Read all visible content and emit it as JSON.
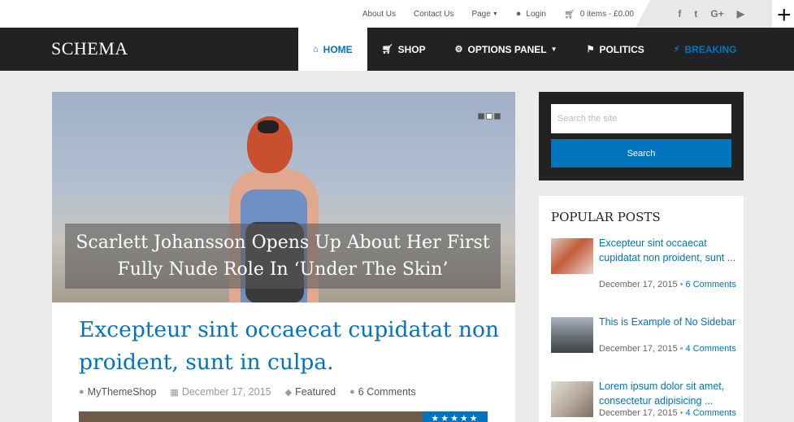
{
  "topbar": {
    "links": [
      "About Us",
      "Contact Us",
      "Page",
      "Login",
      "0 items - £0.00"
    ],
    "social_icons": [
      "facebook-icon",
      "twitter-icon",
      "google-plus-icon",
      "youtube-icon"
    ]
  },
  "brand": "SCHEMA",
  "menu": {
    "home": "HOME",
    "shop": "SHOP",
    "options": "OPTIONS PANEL",
    "politics": "POLITICS",
    "breaking": "BREAKING"
  },
  "slider": {
    "caption": "Scarlett Johansson Opens Up About Her First Fully Nude Role In ‘Under The Skin’",
    "dots": 3,
    "active_dot": 2
  },
  "post": {
    "title": "Excepteur sint occaecat cupidatat non proident, sunt in culpa.",
    "author": "MyThemeShop",
    "date": "December 17, 2015",
    "category": "Featured",
    "comments": "6 Comments",
    "stars": "★★★★★"
  },
  "search": {
    "placeholder": "Search the site",
    "button": "Search"
  },
  "popular": {
    "heading": "POPULAR POSTS",
    "items": [
      {
        "title": "Excepteur sint occaecat cupidatat non proident, sunt ...",
        "date": "December 17, 2015",
        "comments": "6 Comments"
      },
      {
        "title": "This is Example of No Sidebar",
        "date": "December 17, 2015",
        "comments": "4 Comments"
      },
      {
        "title": "Lorem ipsum dolor sit amet, consectetur adipisicing ...",
        "date": "December 17, 2015",
        "comments": "4 Comments"
      }
    ]
  },
  "colors": {
    "accent": "#0274be",
    "nav_bg": "#222222",
    "page_bg": "#ebebeb"
  }
}
